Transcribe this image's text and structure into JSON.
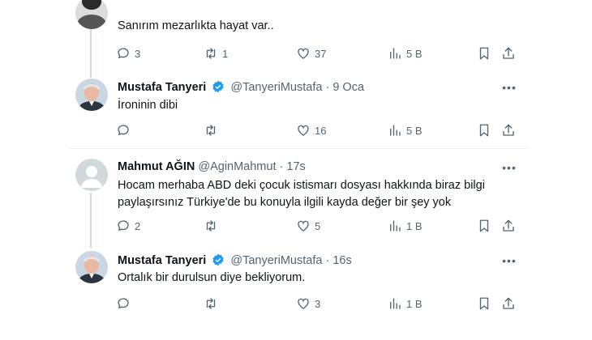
{
  "tweets": [
    {
      "name": "",
      "handle": "",
      "time": "",
      "lines": [
        "Sanırım mezarlıkta hayat var.."
      ],
      "replies": "3",
      "retweets": "1",
      "likes": "37",
      "views": "5 B"
    },
    {
      "name": "Mustafa Tanyeri",
      "handle": "@TanyeriMustafa",
      "time": "9 Oca",
      "lines": [
        "İroninin dibi"
      ],
      "replies": "",
      "retweets": "",
      "likes": "16",
      "views": "5 B"
    },
    {
      "name": "Mahmut AĞIN",
      "handle": "@AginMahmut",
      "time": "17s",
      "lines": [
        "Hocam merhaba ABD deki çocuk istismarı dosyası hakkında biraz bilgi",
        "paylaşırsınız Türkiye'de bu konuyla ilgili kayda değer bir şey yok"
      ],
      "replies": "2",
      "retweets": "",
      "likes": "5",
      "views": "1 B"
    },
    {
      "name": "Mustafa Tanyeri",
      "handle": "@TanyeriMustafa",
      "time": "16s",
      "lines": [
        "Ortalık bir durulsun diye bekliyorum."
      ],
      "replies": "",
      "retweets": "",
      "likes": "3",
      "views": "1 B"
    }
  ],
  "separator": "·",
  "colors": {
    "text": "#0f1419",
    "secondary": "#536471",
    "verified": "#1d9bf0",
    "thread_line": "#cfd9de",
    "divider": "#eff3f4"
  },
  "icons": [
    "reply-icon",
    "retweet-icon",
    "like-icon",
    "views-icon",
    "bookmark-icon",
    "share-icon",
    "more-icon",
    "verified-icon"
  ]
}
